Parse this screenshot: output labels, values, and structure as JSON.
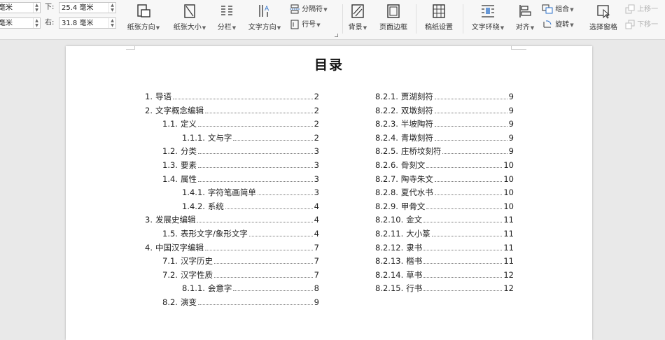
{
  "ribbon": {
    "margins": {
      "left_unit_top": "毫米",
      "bottom_label": "下:",
      "bottom_value": "25.4 毫米",
      "left_unit_bottom": "毫米",
      "right_label": "右:",
      "right_value": "31.8 毫米"
    },
    "tools": {
      "orientation": "纸张方向",
      "size": "纸张大小",
      "columns": "分栏",
      "text_direction": "文字方向",
      "separator": "分隔符",
      "line_number": "行号",
      "background": "背景",
      "page_border": "页面边框",
      "manuscript": "稿纸设置",
      "text_wrap": "文字环绕",
      "align": "对齐",
      "group": "组合",
      "rotate": "旋转",
      "selection_pane": "选择窗格",
      "bring_forward": "上移一",
      "send_backward": "下移一"
    }
  },
  "document": {
    "title": "目录",
    "left_column": [
      {
        "num": "1.",
        "text": "导语",
        "page": "2",
        "level": 1
      },
      {
        "num": "2.",
        "text": "文字概念编辑",
        "page": "2",
        "level": 1
      },
      {
        "num": "1.1.",
        "text": "定义",
        "page": "2",
        "level": 2
      },
      {
        "num": "1.1.1.",
        "text": "文与字",
        "page": "2",
        "level": 3
      },
      {
        "num": "1.2.",
        "text": "分类",
        "page": "3",
        "level": 2
      },
      {
        "num": "1.3.",
        "text": "要素",
        "page": "3",
        "level": 2
      },
      {
        "num": "1.4.",
        "text": "属性",
        "page": "3",
        "level": 2
      },
      {
        "num": "1.4.1.",
        "text": "字符笔画简单",
        "page": "3",
        "level": 3
      },
      {
        "num": "1.4.2.",
        "text": "系统",
        "page": "4",
        "level": 3
      },
      {
        "num": "3.",
        "text": "发展史编辑",
        "page": "4",
        "level": 1
      },
      {
        "num": "1.5.",
        "text": "表形文字/象形文字",
        "page": "4",
        "level": 2
      },
      {
        "num": "4.",
        "text": "中国汉字编辑",
        "page": "7",
        "level": 1
      },
      {
        "num": "7.1.",
        "text": "汉字历史",
        "page": "7",
        "level": 2
      },
      {
        "num": "7.2.",
        "text": "汉字性质",
        "page": "7",
        "level": 2
      },
      {
        "num": "8.1.1.",
        "text": "会意字",
        "page": "8",
        "level": 3
      },
      {
        "num": "8.2.",
        "text": "演变",
        "page": "9",
        "level": 2
      }
    ],
    "right_column": [
      {
        "num": "8.2.1.",
        "text": "贾湖刻符",
        "page": "9"
      },
      {
        "num": "8.2.2.",
        "text": "双墩刻符",
        "page": "9"
      },
      {
        "num": "8.2.3.",
        "text": "半坡陶符",
        "page": "9"
      },
      {
        "num": "8.2.4.",
        "text": "青墩刻符",
        "page": "9"
      },
      {
        "num": "8.2.5.",
        "text": "庄桥坟刻符",
        "page": "9"
      },
      {
        "num": "8.2.6.",
        "text": "骨刻文",
        "page": "10"
      },
      {
        "num": "8.2.7.",
        "text": "陶寺朱文",
        "page": "10"
      },
      {
        "num": "8.2.8.",
        "text": "夏代水书",
        "page": "10"
      },
      {
        "num": "8.2.9.",
        "text": "甲骨文",
        "page": "10"
      },
      {
        "num": "8.2.10.",
        "text": "金文",
        "page": "11"
      },
      {
        "num": "8.2.11.",
        "text": "大小篆",
        "page": "11"
      },
      {
        "num": "8.2.12.",
        "text": "隶书",
        "page": "11"
      },
      {
        "num": "8.2.13.",
        "text": "楷书",
        "page": "11"
      },
      {
        "num": "8.2.14.",
        "text": "草书",
        "page": "12"
      },
      {
        "num": "8.2.15.",
        "text": "行书",
        "page": "12"
      }
    ]
  }
}
